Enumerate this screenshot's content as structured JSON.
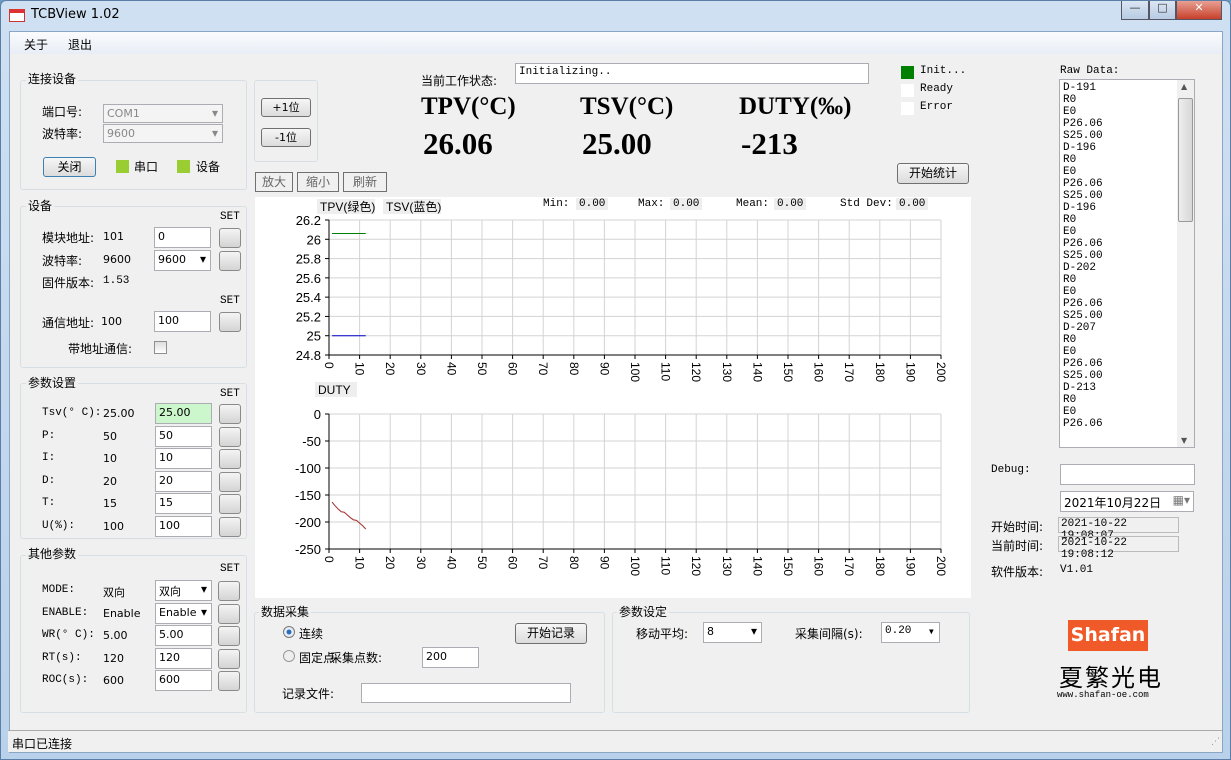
{
  "window": {
    "title": "TCBView 1.02",
    "minimize": "—",
    "maximize": "□",
    "close": "✕"
  },
  "menu": [
    "关于",
    "退出"
  ],
  "connect": {
    "title": "连接设备",
    "port_label": "端口号:",
    "port_value": "COM1",
    "baud_label": "波特率:",
    "baud_value": "9600",
    "close_button": "关闭",
    "serial_lamp": "串口",
    "device_lamp": "设备",
    "lamp_color": "#9acd32"
  },
  "device": {
    "title": "设备",
    "set": "SET",
    "module_addr_label": "模块地址:",
    "module_addr_value": "101",
    "module_addr_input": "0",
    "baud_label": "波特率:",
    "baud_value": "9600",
    "baud_select": "9600",
    "firmware_label": "固件版本:",
    "firmware_value": "1.53",
    "comm_addr_label": "通信地址:",
    "comm_addr_value": "100",
    "comm_addr_input": "100",
    "with_addr_label": "带地址通信:"
  },
  "params": {
    "title": "参数设置",
    "set": "SET",
    "rows": [
      {
        "label": "Tsv(° C):",
        "value": "25.00",
        "input": "25.00"
      },
      {
        "label": "P:",
        "value": "50",
        "input": "50"
      },
      {
        "label": "I:",
        "value": "10",
        "input": "10"
      },
      {
        "label": "D:",
        "value": "20",
        "input": "20"
      },
      {
        "label": "T:",
        "value": "15",
        "input": "15"
      },
      {
        "label": "U(%):",
        "value": "100",
        "input": "100"
      }
    ]
  },
  "other": {
    "title": "其他参数",
    "set": "SET",
    "rows": [
      {
        "label": "MODE:",
        "value": "双向",
        "input": "双向"
      },
      {
        "label": "ENABLE:",
        "value": "Enable",
        "input": "Enable"
      },
      {
        "label": "WR(° C):",
        "value": "5.00",
        "input": "5.00"
      },
      {
        "label": "RT(s):",
        "value": "120",
        "input": "120"
      },
      {
        "label": "ROC(s):",
        "value": "600",
        "input": "600"
      }
    ]
  },
  "digit": {
    "plus": "+1位",
    "minus": "-1位"
  },
  "status": {
    "label": "当前工作状态:",
    "value": "Initializing..",
    "lamps": [
      {
        "label": "Init...",
        "color": "#008000"
      },
      {
        "label": "Ready",
        "color": "#ffffff"
      },
      {
        "label": "Error",
        "color": "#ffffff"
      }
    ]
  },
  "readouts": [
    {
      "label": "TPV(°C)",
      "value": "26.06"
    },
    {
      "label": "TSV(°C)",
      "value": "25.00"
    },
    {
      "label": "DUTY(‰)",
      "value": "-213"
    }
  ],
  "start_stats": "开始统计",
  "chart_tools": [
    "放大",
    "缩小",
    "刷新"
  ],
  "stats": {
    "min_label": "Min:",
    "min": "0.00",
    "max_label": "Max:",
    "max": "0.00",
    "mean_label": "Mean:",
    "mean": "0.00",
    "std_label": "Std Dev:",
    "std": "0.00"
  },
  "chart_data": [
    {
      "type": "line",
      "title": "",
      "legend": [
        "TPV(绿色)",
        "TSV(蓝色)"
      ],
      "xlim": [
        0,
        200
      ],
      "ylim": [
        24.8,
        26.2
      ],
      "xticks": [
        "0",
        "10",
        "20",
        "30",
        "40",
        "50",
        "60",
        "70",
        "80",
        "90",
        "100",
        "110",
        "120",
        "130",
        "140",
        "150",
        "160",
        "170",
        "180",
        "190",
        "200"
      ],
      "yticks": [
        "26.2",
        "26",
        "25.8",
        "25.6",
        "25.4",
        "25.2",
        "25",
        "24.8"
      ],
      "grid": true,
      "series": [
        {
          "name": "TPV",
          "color": "#008000",
          "x": [
            1,
            12
          ],
          "y": [
            26.06,
            26.06
          ]
        },
        {
          "name": "TSV",
          "color": "#0000cc",
          "x": [
            1,
            12
          ],
          "y": [
            25.0,
            25.0
          ]
        }
      ]
    },
    {
      "type": "line",
      "title": "",
      "legend": [
        "DUTY"
      ],
      "xlim": [
        0,
        200
      ],
      "ylim": [
        -250,
        0
      ],
      "xticks": [
        "0",
        "10",
        "20",
        "30",
        "40",
        "50",
        "60",
        "70",
        "80",
        "90",
        "100",
        "110",
        "120",
        "130",
        "140",
        "150",
        "160",
        "170",
        "180",
        "190",
        "200"
      ],
      "yticks": [
        "0",
        "-50",
        "-100",
        "-150",
        "-200",
        "-250"
      ],
      "grid": true,
      "series": [
        {
          "name": "DUTY",
          "color": "#a52a2a",
          "x": [
            1,
            2,
            3,
            4,
            5,
            6,
            7,
            8,
            9,
            10,
            11,
            12
          ],
          "y": [
            -163,
            -170,
            -176,
            -181,
            -182,
            -187,
            -192,
            -196,
            -197,
            -202,
            -207,
            -213
          ]
        }
      ]
    }
  ],
  "acq": {
    "title": "数据采集",
    "continuous": "连续",
    "fixed": "固定点",
    "points_label": "采集点数:",
    "points": "200",
    "record_button": "开始记录",
    "file_label": "记录文件:",
    "file": ""
  },
  "setting": {
    "title": "参数设定",
    "avg_label": "移动平均:",
    "avg": "8",
    "interval_label": "采集间隔(s):",
    "interval": "0.20"
  },
  "raw": {
    "label": "Raw Data:",
    "lines": [
      "D-191",
      "R0",
      "E0",
      "P26.06",
      "S25.00",
      "D-196",
      "R0",
      "E0",
      "P26.06",
      "S25.00",
      "D-196",
      "R0",
      "E0",
      "P26.06",
      "S25.00",
      "D-202",
      "R0",
      "E0",
      "P26.06",
      "S25.00",
      "D-207",
      "R0",
      "E0",
      "P26.06",
      "S25.00",
      "D-213",
      "R0",
      "E0",
      "P26.06"
    ]
  },
  "debug": {
    "label": "Debug:",
    "value": ""
  },
  "date": "2021年10月22日",
  "start_time_label": "开始时间:",
  "start_time": "2021-10-22 19:08:07",
  "current_time_label": "当前时间:",
  "current_time": "2021-10-22 19:08:12",
  "version_label": "软件版本:",
  "version": "V1.01",
  "logo": {
    "brand": "Shafan",
    "name": "夏繁光电",
    "url": "www.shafan-oe.com",
    "color": "#f05a28"
  },
  "statusbar": "串口已连接"
}
